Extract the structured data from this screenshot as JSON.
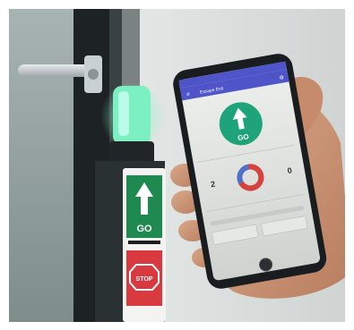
{
  "door_sign": {
    "go_label": "GO",
    "stop_label": "STOP"
  },
  "phone_app": {
    "header_title": "Escape Exit",
    "go_label": "GO",
    "stat_left": "2",
    "stat_right": "0"
  },
  "colors": {
    "sign_green": "#1f8a4f",
    "sign_red": "#d93a3f",
    "app_header": "#4f55c9",
    "app_circle": "#1fa37a",
    "beacon_green": "#7cf0c2",
    "donut_red": "#d8423b",
    "donut_blue": "#4f6fc9"
  }
}
